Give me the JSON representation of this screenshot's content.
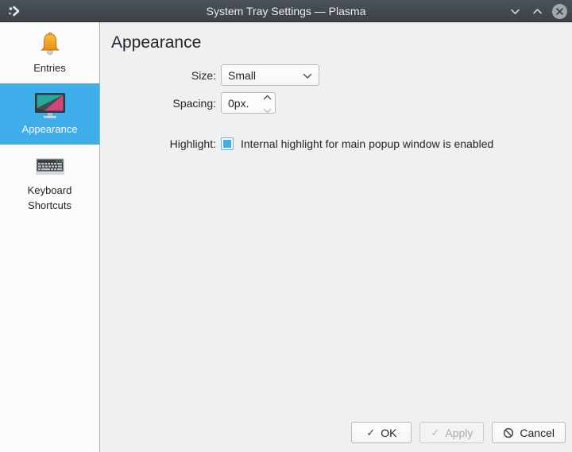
{
  "window": {
    "title": "System Tray Settings — Plasma"
  },
  "sidebar": {
    "items": [
      {
        "label": "Entries",
        "icon": "bell-icon",
        "selected": false
      },
      {
        "label": "Appearance",
        "icon": "monitor-icon",
        "selected": true
      },
      {
        "label": "Keyboard Shortcuts",
        "icon": "keyboard-icon",
        "selected": false
      }
    ]
  },
  "content": {
    "heading": "Appearance",
    "size": {
      "label": "Size:",
      "value": "Small"
    },
    "spacing": {
      "label": "Spacing:",
      "value": "0px."
    },
    "highlight": {
      "label": "Highlight:",
      "checked": true,
      "text": "Internal highlight for main popup window is enabled"
    }
  },
  "buttons": {
    "ok": "OK",
    "apply": "Apply",
    "cancel": "Cancel"
  },
  "colors": {
    "accent": "#3daee9",
    "titlebar": "#424950",
    "window_bg": "#eff0f1",
    "sidebar_bg": "#fbfbfc"
  }
}
